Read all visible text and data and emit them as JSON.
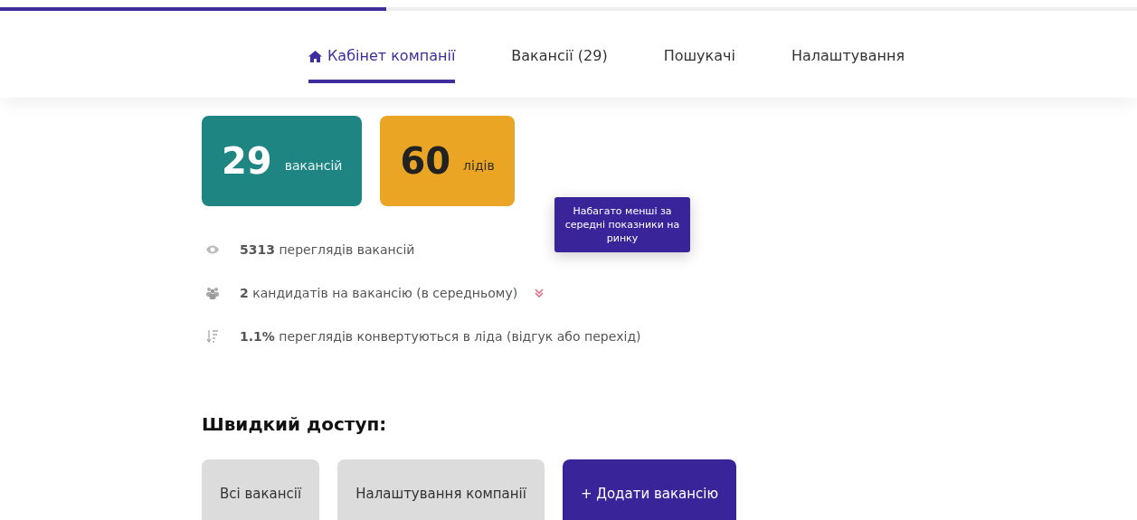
{
  "progress": {
    "level": 0.34
  },
  "tabs": [
    {
      "label": "Кабінет компанії",
      "selected": true,
      "home": true
    },
    {
      "label": "Вакансії (29)",
      "selected": false,
      "home": false
    },
    {
      "label": "Пошукачі",
      "selected": false,
      "home": false
    },
    {
      "label": "Налаштування",
      "selected": false,
      "home": false
    }
  ],
  "counters": [
    {
      "value": "29",
      "label": "вакансій",
      "color": "#1f8583"
    },
    {
      "value": "60",
      "label": "лідів",
      "color": "#eba525"
    }
  ],
  "stats": [
    {
      "kind": "views",
      "text": "**5313** переглядів вакансій",
      "below_average": false
    },
    {
      "kind": "candidates",
      "text": "**2** кандидатів на вакансію (в середньому)",
      "below_average": true
    },
    {
      "kind": "conversion",
      "text": "**1.1%** переглядів конвертуються в ліда (відгук або перехід)",
      "below_average": false
    }
  ],
  "tooltip": {
    "text": "Набагато менші за середні показники на ринку"
  },
  "quick_access": {
    "title": "Швидкий доступ:",
    "buttons": [
      {
        "label": "Всі вакансії",
        "kind": "secondary"
      },
      {
        "label": "Налаштування компанії",
        "kind": "secondary"
      },
      {
        "label": "+ Додати вакансію",
        "kind": "primary"
      }
    ]
  }
}
